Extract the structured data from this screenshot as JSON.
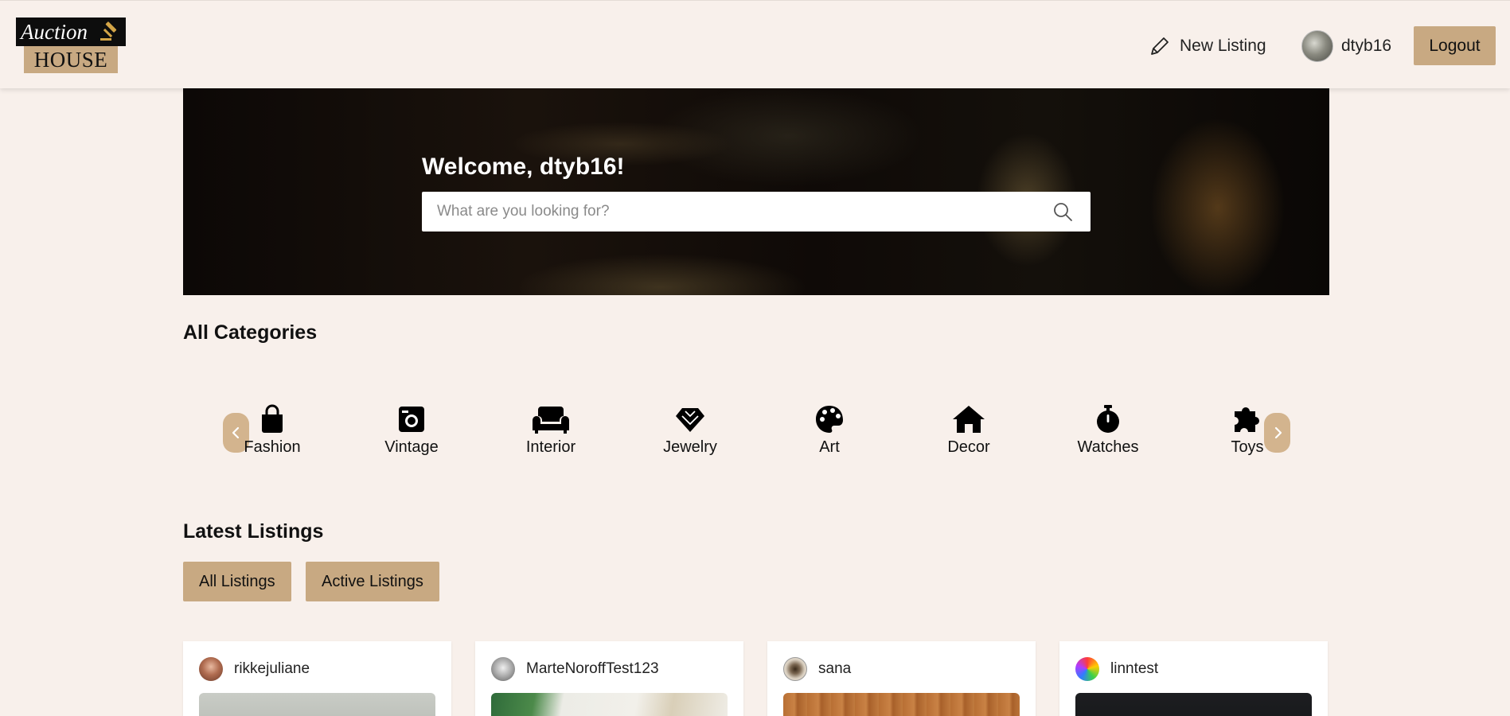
{
  "header": {
    "logo_top": "Auction",
    "logo_bottom": "HOUSE",
    "new_listing_label": "New Listing",
    "username": "dtyb16",
    "logout_label": "Logout"
  },
  "hero": {
    "welcome": "Welcome, dtyb16!",
    "search_placeholder": "What are you looking for?",
    "search_value": ""
  },
  "categories": {
    "title": "All Categories",
    "items": [
      {
        "label": "Fashion",
        "icon": "shopping-bag-icon"
      },
      {
        "label": "Vintage",
        "icon": "camera-icon"
      },
      {
        "label": "Interior",
        "icon": "couch-icon"
      },
      {
        "label": "Jewelry",
        "icon": "gem-icon"
      },
      {
        "label": "Art",
        "icon": "palette-icon"
      },
      {
        "label": "Decor",
        "icon": "house-icon"
      },
      {
        "label": "Watches",
        "icon": "stopwatch-icon"
      },
      {
        "label": "Toys",
        "icon": "puzzle-icon"
      }
    ]
  },
  "listings": {
    "title": "Latest Listings",
    "filters": [
      "All Listings",
      "Active Listings"
    ],
    "cards": [
      {
        "user": "rikkejuliane"
      },
      {
        "user": "MarteNoroffTest123"
      },
      {
        "user": "sana"
      },
      {
        "user": "linntest"
      }
    ]
  },
  "colors": {
    "background": "#f8f0eb",
    "accent": "#c8a982",
    "arrow": "#d3b48e",
    "logo_dark": "#0d0d0d"
  }
}
